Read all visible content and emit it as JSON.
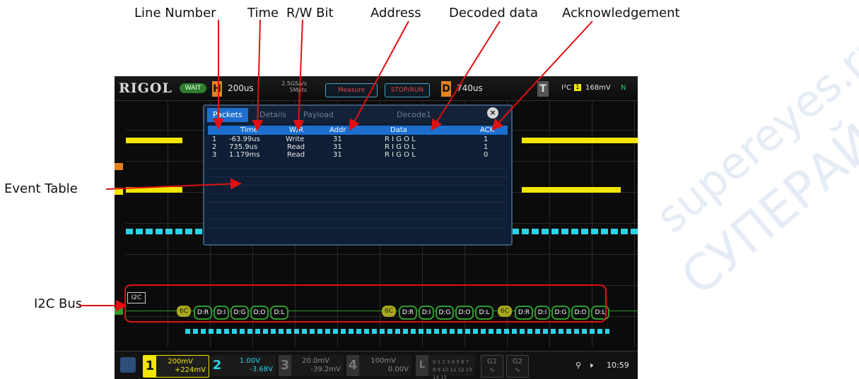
{
  "callouts": {
    "line_number": "Line Number",
    "time": "Time",
    "rw_bit": "R/W Bit",
    "address": "Address",
    "decoded_data": "Decoded data",
    "acknowledgement": "Acknowledgement",
    "event_table": "Event  Table",
    "i2c_bus": "I2C  Bus"
  },
  "watermark": [
    "supereyes.ru",
    "СУПЕРАЙС"
  ],
  "scope": {
    "logo": "RIGOL",
    "status": "WAIT",
    "timebase_label": "H",
    "timebase": "200us",
    "sample_rate": "2.5GSa/s",
    "memory_depth": "5Mpts",
    "measure_button": "Measure",
    "stop_run_button": "STOP/RUN",
    "delay_label": "D",
    "delay": "740us",
    "trigger_label": "T",
    "trigger_type": "I²C",
    "trigger_source": "1",
    "trigger_level": "168mV",
    "trigger_mode": "N",
    "colors": {
      "ch1": "#f2e600",
      "ch2": "#2ad4e6",
      "bus": "#2f9a2f",
      "accent": "#1f6fd0"
    }
  },
  "event_table": {
    "tabs": [
      "Packets",
      "Details",
      "Payload"
    ],
    "decoder": "Decode1",
    "close_icon": "×",
    "headers": [
      "",
      "Time",
      "W/R",
      "Addr",
      "Data",
      "ACK"
    ],
    "rows": [
      {
        "line": "1",
        "time": "-63.99us",
        "wr": "Write",
        "addr": "31",
        "data": "R I G O L",
        "ack": "1"
      },
      {
        "line": "2",
        "time": "735.9us",
        "wr": "Read",
        "addr": "31",
        "data": "R I G O L",
        "ack": "1"
      },
      {
        "line": "3",
        "time": "1.179ms",
        "wr": "Read",
        "addr": "31",
        "data": "R I G O L",
        "ack": "0"
      }
    ]
  },
  "bus": {
    "label": "I2C",
    "packets": [
      [
        "6C",
        "D:R",
        "D:I",
        "D:G",
        "D:O",
        "D:L"
      ],
      [
        "6C",
        "D:R",
        "D:I",
        "D:G",
        "D:O",
        "D:L"
      ],
      [
        "6C",
        "D:R",
        "D:I",
        "D:G",
        "D:O",
        "D:L"
      ]
    ]
  },
  "channels": [
    {
      "num": "1",
      "scale": "200mV",
      "offset": "+224mV",
      "color": "#f2e600",
      "active": true
    },
    {
      "num": "2",
      "scale": "1.00V",
      "offset": "-3.68V",
      "color": "#2ad4e6",
      "active": true
    },
    {
      "num": "3",
      "scale": "20.0mV",
      "offset": "-39.2mV",
      "color": "#888888",
      "active": false
    },
    {
      "num": "4",
      "scale": "100mV",
      "offset": "0.00V",
      "color": "#888888",
      "active": false
    }
  ],
  "logic": {
    "label": "L",
    "row1": "0 1 2 3  4 5 6 7",
    "row2": "8 9 10 11 12 13 14 15"
  },
  "gen_buttons": [
    "G1",
    "G2"
  ],
  "clock": "10:59"
}
